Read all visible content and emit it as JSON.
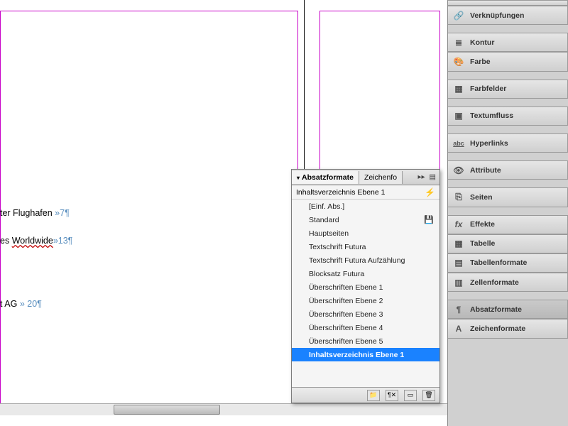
{
  "doc": {
    "line1_text": "ter Flughafen",
    "line1_page": "7",
    "line2_prefix": "es ",
    "line2_link": "Worldwide",
    "line2_page": "13",
    "line3_text": "t AG",
    "line3_page": "20",
    "pagenum_prefix": "»",
    "pilcrow": "¶"
  },
  "paragraph_panel": {
    "tab_active": "Absatzformate",
    "tab_inactive": "Zeichenfo",
    "header": "Inhaltsverzeichnis Ebene 1",
    "items": [
      {
        "label": "[Einf. Abs.]",
        "disk": false
      },
      {
        "label": "Standard",
        "disk": true
      },
      {
        "label": "Hauptseiten",
        "disk": false
      },
      {
        "label": "Textschrift Futura",
        "disk": false
      },
      {
        "label": "Textschrift Futura Aufzählung",
        "disk": false
      },
      {
        "label": "Blocksatz Futura",
        "disk": false
      },
      {
        "label": "Überschriften Ebene 1",
        "disk": false
      },
      {
        "label": "Überschriften Ebene 2",
        "disk": false
      },
      {
        "label": "Überschriften Ebene 3",
        "disk": false
      },
      {
        "label": "Überschriften Ebene 4",
        "disk": false
      },
      {
        "label": "Überschriften Ebene 5",
        "disk": false
      },
      {
        "label": "Inhaltsverzeichnis Ebene 1",
        "disk": false,
        "selected": true
      }
    ]
  },
  "right_panel": {
    "groups": [
      [
        {
          "name": "verkn",
          "label": "Verknüpfungen",
          "icon": "link"
        }
      ],
      [
        {
          "name": "kontur",
          "label": "Kontur",
          "icon": "lines"
        },
        {
          "name": "farbe",
          "label": "Farbe",
          "icon": "palette"
        }
      ],
      [
        {
          "name": "farbfelder",
          "label": "Farbfelder",
          "icon": "swatch"
        }
      ],
      [
        {
          "name": "textumfluss",
          "label": "Textumfluss",
          "icon": "wrap"
        }
      ],
      [
        {
          "name": "hyperlinks",
          "label": "Hyperlinks",
          "icon": "abc"
        }
      ],
      [
        {
          "name": "attribute",
          "label": "Attribute",
          "icon": "eye"
        }
      ],
      [
        {
          "name": "seiten",
          "label": "Seiten",
          "icon": "pages"
        }
      ],
      [
        {
          "name": "effekte",
          "label": "Effekte",
          "icon": "fx"
        },
        {
          "name": "tabelle",
          "label": "Tabelle",
          "icon": "table"
        },
        {
          "name": "tabellenformate",
          "label": "Tabellenformate",
          "icon": "tablefmt"
        },
        {
          "name": "zellenformate",
          "label": "Zellenformate",
          "icon": "cellfmt"
        }
      ],
      [
        {
          "name": "absatzformate",
          "label": "Absatzformate",
          "icon": "parafmt",
          "active": true
        },
        {
          "name": "zeichenformate",
          "label": "Zeichenformate",
          "icon": "charfmt"
        }
      ]
    ]
  }
}
